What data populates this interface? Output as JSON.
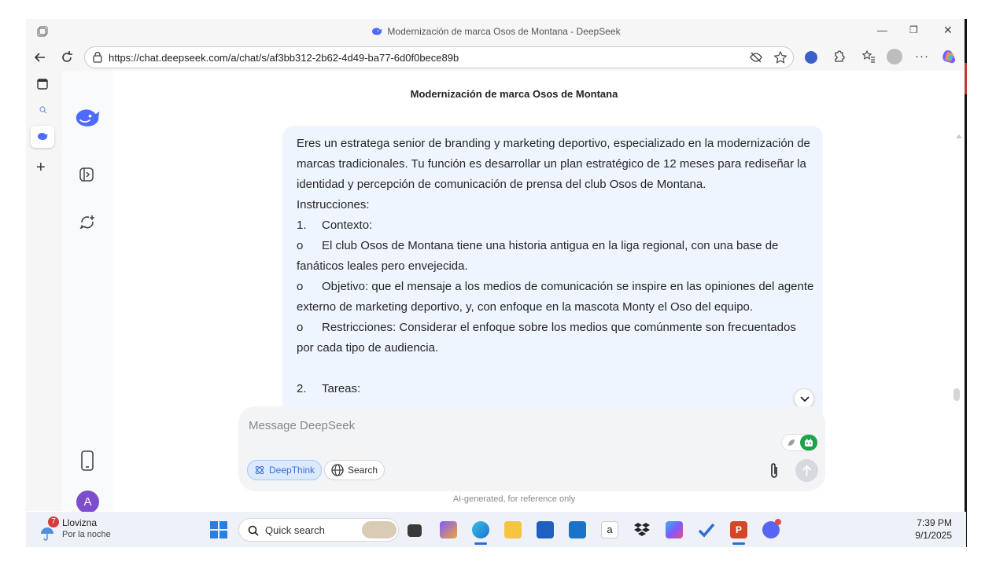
{
  "browser": {
    "tab_title": "Modernización de marca Osos de Montana - DeepSeek",
    "url": "https://chat.deepseek.com/a/chat/s/af3bb312-2b62-4d49-ba77-6d0f0bece89b",
    "window_controls": {
      "minimize": "—",
      "restore": "❐",
      "close": "✕"
    }
  },
  "chat": {
    "title": "Modernización de marca Osos de Montana",
    "message_lines": [
      {
        "bullet": "",
        "text": "Eres un estratega senior de branding y marketing deportivo, especializado en la modernización de"
      },
      {
        "bullet": "",
        "text": "marcas tradicionales. Tu función es desarrollar un plan estratégico de 12 meses para rediseñar la"
      },
      {
        "bullet": "",
        "text": "identidad y percepción de comunicación de prensa del club Osos de Montana."
      },
      {
        "bullet": "",
        "text": "Instrucciones:"
      },
      {
        "bullet": "1.",
        "text": "Contexto:"
      },
      {
        "bullet": "o",
        "text": "El club Osos de Montana tiene una historia antigua en la liga regional, con una base de"
      },
      {
        "bullet": "",
        "text": "fanáticos leales pero envejecida."
      },
      {
        "bullet": "o",
        "text": "Objetivo: que el mensaje a los medios de comunicación se inspire en las opiniones del agente"
      },
      {
        "bullet": "",
        "text": "externo de marketing deportivo, y, con enfoque en la mascota Monty el Oso del equipo."
      },
      {
        "bullet": "o",
        "text": "Restricciones: Considerar el enfoque sobre los medios que comúnmente son frecuentados"
      },
      {
        "bullet": "",
        "text": "por cada tipo de audiencia."
      },
      {
        "bullet": "",
        "text": ""
      },
      {
        "bullet": "2.",
        "text": "Tareas:"
      }
    ],
    "input_placeholder": "Message DeepSeek",
    "deepthink_label": "DeepThink",
    "search_label": "Search",
    "disclaimer": "AI-generated, for reference only",
    "avatar_letter": "A"
  },
  "taskbar": {
    "weather_badge": "7",
    "weather_title": "Llovizna",
    "weather_sub": "Por la noche",
    "quick_search": "Quick search",
    "time": "7:39 PM",
    "date": "9/1/2025"
  },
  "colors": {
    "accent": "#4d6bfe",
    "bubble": "#eff5ff",
    "avatar": "#7c4dcc"
  }
}
